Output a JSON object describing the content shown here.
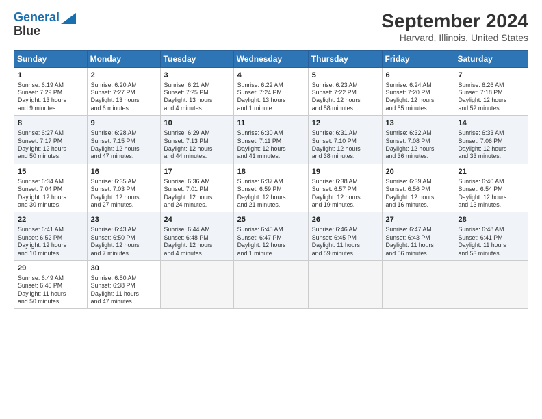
{
  "header": {
    "logo_line1": "General",
    "logo_line2": "Blue",
    "title": "September 2024",
    "subtitle": "Harvard, Illinois, United States"
  },
  "weekdays": [
    "Sunday",
    "Monday",
    "Tuesday",
    "Wednesday",
    "Thursday",
    "Friday",
    "Saturday"
  ],
  "weeks": [
    [
      {
        "day": "1",
        "info": "Sunrise: 6:19 AM\nSunset: 7:29 PM\nDaylight: 13 hours\nand 9 minutes."
      },
      {
        "day": "2",
        "info": "Sunrise: 6:20 AM\nSunset: 7:27 PM\nDaylight: 13 hours\nand 6 minutes."
      },
      {
        "day": "3",
        "info": "Sunrise: 6:21 AM\nSunset: 7:25 PM\nDaylight: 13 hours\nand 4 minutes."
      },
      {
        "day": "4",
        "info": "Sunrise: 6:22 AM\nSunset: 7:24 PM\nDaylight: 13 hours\nand 1 minute."
      },
      {
        "day": "5",
        "info": "Sunrise: 6:23 AM\nSunset: 7:22 PM\nDaylight: 12 hours\nand 58 minutes."
      },
      {
        "day": "6",
        "info": "Sunrise: 6:24 AM\nSunset: 7:20 PM\nDaylight: 12 hours\nand 55 minutes."
      },
      {
        "day": "7",
        "info": "Sunrise: 6:26 AM\nSunset: 7:18 PM\nDaylight: 12 hours\nand 52 minutes."
      }
    ],
    [
      {
        "day": "8",
        "info": "Sunrise: 6:27 AM\nSunset: 7:17 PM\nDaylight: 12 hours\nand 50 minutes."
      },
      {
        "day": "9",
        "info": "Sunrise: 6:28 AM\nSunset: 7:15 PM\nDaylight: 12 hours\nand 47 minutes."
      },
      {
        "day": "10",
        "info": "Sunrise: 6:29 AM\nSunset: 7:13 PM\nDaylight: 12 hours\nand 44 minutes."
      },
      {
        "day": "11",
        "info": "Sunrise: 6:30 AM\nSunset: 7:11 PM\nDaylight: 12 hours\nand 41 minutes."
      },
      {
        "day": "12",
        "info": "Sunrise: 6:31 AM\nSunset: 7:10 PM\nDaylight: 12 hours\nand 38 minutes."
      },
      {
        "day": "13",
        "info": "Sunrise: 6:32 AM\nSunset: 7:08 PM\nDaylight: 12 hours\nand 36 minutes."
      },
      {
        "day": "14",
        "info": "Sunrise: 6:33 AM\nSunset: 7:06 PM\nDaylight: 12 hours\nand 33 minutes."
      }
    ],
    [
      {
        "day": "15",
        "info": "Sunrise: 6:34 AM\nSunset: 7:04 PM\nDaylight: 12 hours\nand 30 minutes."
      },
      {
        "day": "16",
        "info": "Sunrise: 6:35 AM\nSunset: 7:03 PM\nDaylight: 12 hours\nand 27 minutes."
      },
      {
        "day": "17",
        "info": "Sunrise: 6:36 AM\nSunset: 7:01 PM\nDaylight: 12 hours\nand 24 minutes."
      },
      {
        "day": "18",
        "info": "Sunrise: 6:37 AM\nSunset: 6:59 PM\nDaylight: 12 hours\nand 21 minutes."
      },
      {
        "day": "19",
        "info": "Sunrise: 6:38 AM\nSunset: 6:57 PM\nDaylight: 12 hours\nand 19 minutes."
      },
      {
        "day": "20",
        "info": "Sunrise: 6:39 AM\nSunset: 6:56 PM\nDaylight: 12 hours\nand 16 minutes."
      },
      {
        "day": "21",
        "info": "Sunrise: 6:40 AM\nSunset: 6:54 PM\nDaylight: 12 hours\nand 13 minutes."
      }
    ],
    [
      {
        "day": "22",
        "info": "Sunrise: 6:41 AM\nSunset: 6:52 PM\nDaylight: 12 hours\nand 10 minutes."
      },
      {
        "day": "23",
        "info": "Sunrise: 6:43 AM\nSunset: 6:50 PM\nDaylight: 12 hours\nand 7 minutes."
      },
      {
        "day": "24",
        "info": "Sunrise: 6:44 AM\nSunset: 6:48 PM\nDaylight: 12 hours\nand 4 minutes."
      },
      {
        "day": "25",
        "info": "Sunrise: 6:45 AM\nSunset: 6:47 PM\nDaylight: 12 hours\nand 1 minute."
      },
      {
        "day": "26",
        "info": "Sunrise: 6:46 AM\nSunset: 6:45 PM\nDaylight: 11 hours\nand 59 minutes."
      },
      {
        "day": "27",
        "info": "Sunrise: 6:47 AM\nSunset: 6:43 PM\nDaylight: 11 hours\nand 56 minutes."
      },
      {
        "day": "28",
        "info": "Sunrise: 6:48 AM\nSunset: 6:41 PM\nDaylight: 11 hours\nand 53 minutes."
      }
    ],
    [
      {
        "day": "29",
        "info": "Sunrise: 6:49 AM\nSunset: 6:40 PM\nDaylight: 11 hours\nand 50 minutes."
      },
      {
        "day": "30",
        "info": "Sunrise: 6:50 AM\nSunset: 6:38 PM\nDaylight: 11 hours\nand 47 minutes."
      },
      {
        "day": "",
        "info": ""
      },
      {
        "day": "",
        "info": ""
      },
      {
        "day": "",
        "info": ""
      },
      {
        "day": "",
        "info": ""
      },
      {
        "day": "",
        "info": ""
      }
    ]
  ]
}
